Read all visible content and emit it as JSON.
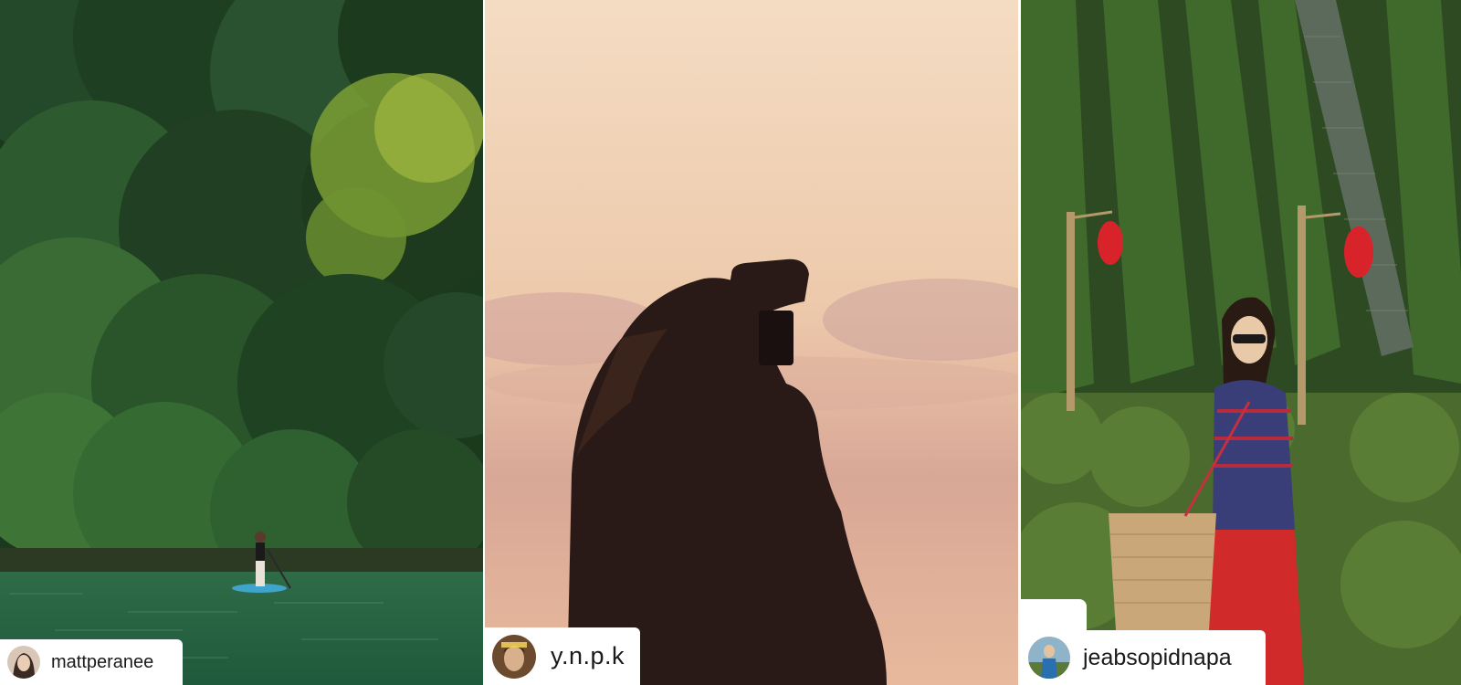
{
  "collage": {
    "panels": [
      {
        "id": "panel-1",
        "scene": "forest river paddleboard",
        "handle": "mattperanee"
      },
      {
        "id": "panel-2",
        "scene": "sunset silhouette photographer",
        "handle": "y.n.p.k"
      },
      {
        "id": "panel-3",
        "scene": "tea plantation with red lanterns",
        "handle": "jeabsopidnapa"
      }
    ]
  },
  "colors": {
    "tag_background": "#ffffff",
    "handle_text": "#1a1a1a",
    "forest_dark": "#1d3b1c",
    "sunset_sky": "#f3d9bd",
    "lantern_red": "#d9232b"
  }
}
